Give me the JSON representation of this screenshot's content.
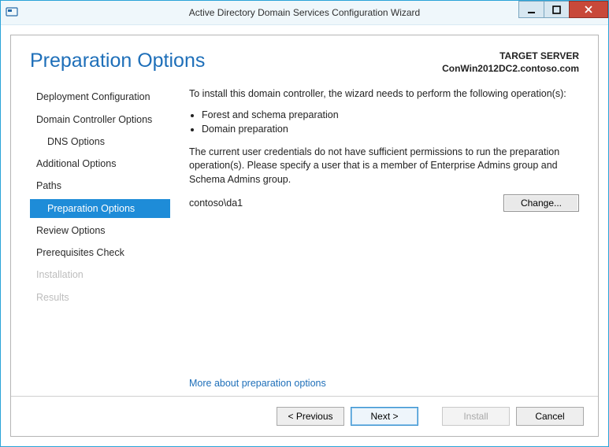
{
  "window": {
    "title": "Active Directory Domain Services Configuration Wizard"
  },
  "header": {
    "page_title": "Preparation Options",
    "target_label": "TARGET SERVER",
    "target_server": "ConWin2012DC2.contoso.com"
  },
  "sidebar": {
    "items": [
      {
        "label": "Deployment Configuration",
        "indent": 0,
        "state": "normal"
      },
      {
        "label": "Domain Controller Options",
        "indent": 0,
        "state": "normal"
      },
      {
        "label": "DNS Options",
        "indent": 1,
        "state": "normal"
      },
      {
        "label": "Additional Options",
        "indent": 0,
        "state": "normal"
      },
      {
        "label": "Paths",
        "indent": 0,
        "state": "normal"
      },
      {
        "label": "Preparation Options",
        "indent": 1,
        "state": "selected"
      },
      {
        "label": "Review Options",
        "indent": 0,
        "state": "normal"
      },
      {
        "label": "Prerequisites Check",
        "indent": 0,
        "state": "normal"
      },
      {
        "label": "Installation",
        "indent": 0,
        "state": "disabled"
      },
      {
        "label": "Results",
        "indent": 0,
        "state": "disabled"
      }
    ]
  },
  "main": {
    "intro": "To install this domain controller, the wizard needs to perform the following operation(s):",
    "ops": [
      "Forest and schema preparation",
      "Domain preparation"
    ],
    "perm_text": "The current user credentials do not have sufficient permissions to run the preparation operation(s). Please specify a user that is a member of Enterprise Admins group and Schema Admins group.",
    "credential": "contoso\\da1",
    "change_label": "Change...",
    "more_link": "More about preparation options"
  },
  "footer": {
    "previous": "< Previous",
    "next": "Next >",
    "install": "Install",
    "cancel": "Cancel"
  }
}
